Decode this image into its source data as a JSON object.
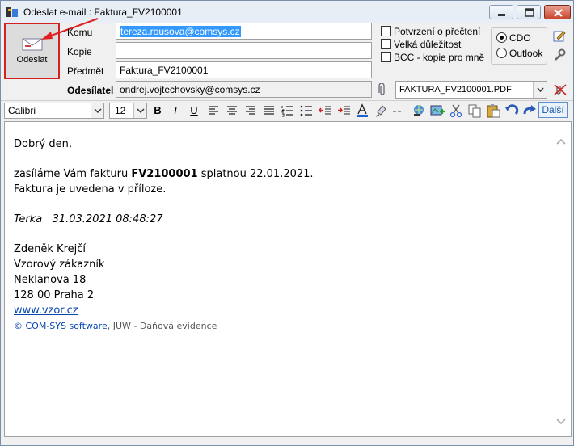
{
  "window": {
    "title": "Odeslat e-mail : Faktura_FV2100001"
  },
  "send_button": {
    "label": "Odeslat"
  },
  "fields": {
    "to": {
      "label": "Komu",
      "value": "tereza.rousova@comsys.cz"
    },
    "cc": {
      "label": "Kopie",
      "value": ""
    },
    "subject": {
      "label": "Předmět",
      "value": "Faktura_FV2100001"
    },
    "sender": {
      "label": "Odesílatel",
      "value": "ondrej.vojtechovsky@comsys.cz"
    }
  },
  "options": {
    "read_receipt": "Potvrzení o přečtení",
    "high_importance": "Velká důležitost",
    "bcc_copy": "BCC - kopie pro mně"
  },
  "transport": {
    "cdo": "CDO",
    "outlook": "Outlook",
    "selected": "CDO"
  },
  "attachment": {
    "value": "FAKTURA_FV2100001.PDF"
  },
  "toolbar": {
    "font": "Calibri",
    "size": "12",
    "bold": "B",
    "italic": "I",
    "underline": "U",
    "more_label": "Další"
  },
  "body": {
    "greeting": "Dobrý den,",
    "line1_pre": "zasíláme Vám fakturu ",
    "line1_bold": "FV2100001",
    "line1_post": " splatnou 22.01.2021.",
    "line2": "Faktura je uvedena v příloze.",
    "signature_note": "Terka   31.03.2021 08:48:27",
    "name": "Zdeněk Krejčí",
    "company": "Vzorový zákazník",
    "street": "Neklanova 18",
    "city": "128 00 Praha 2",
    "website": "www.vzor.cz",
    "footer_link": "© COM-SYS software",
    "footer_text": ",  JUW - Daňová evidence"
  }
}
